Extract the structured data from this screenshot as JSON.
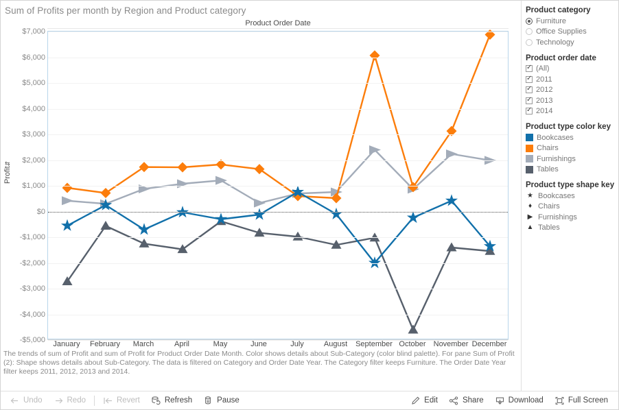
{
  "viz": {
    "title": "Sum of Profits per month by Region and Product category",
    "column_header": "Product Order Date",
    "yaxis_title": "Profit",
    "yaxis_sort_glyph": "⇵",
    "caption": "The trends of sum of Profit and sum of Profit for Product Order Date Month.  Color shows details about Sub-Category (color blind palette).  For pane Sum of Profit (2):  Shape shows details about Sub-Category. The data is filtered on Category and Order Date Year. The Category filter keeps Furniture. The Order Date Year filter keeps 2011, 2012, 2013 and 2014."
  },
  "chart_data": {
    "type": "line",
    "title": "Sum of Profits per month by Region and Product category",
    "xlabel": "Product Order Date",
    "ylabel": "Profit",
    "ylim": [
      -5000,
      7000
    ],
    "ytick_step": 1000,
    "grid": true,
    "legend_position": "right",
    "categories": [
      "January",
      "February",
      "March",
      "April",
      "May",
      "June",
      "July",
      "August",
      "September",
      "October",
      "November",
      "December"
    ],
    "ytick_labels": [
      "$7,000",
      "$6,000",
      "$5,000",
      "$4,000",
      "$3,000",
      "$2,000",
      "$1,000",
      "$0",
      "-$1,000",
      "-$2,000",
      "-$3,000",
      "-$4,000",
      "-$5,000"
    ],
    "series": [
      {
        "name": "Bookcases",
        "color": "#1170aa",
        "shape": "star",
        "values": [
          -550,
          250,
          -700,
          -30,
          -300,
          -120,
          760,
          -100,
          -2000,
          -240,
          420,
          -1350
        ]
      },
      {
        "name": "Chairs",
        "color": "#fc7d0b",
        "shape": "diamond",
        "values": [
          920,
          720,
          1730,
          1720,
          1830,
          1650,
          600,
          520,
          6070,
          950,
          3130,
          6880
        ]
      },
      {
        "name": "Furnishings",
        "color": "#a3acb9",
        "shape": "triangle-right",
        "values": [
          420,
          300,
          880,
          1080,
          1210,
          330,
          700,
          760,
          2400,
          870,
          2240,
          1990
        ]
      },
      {
        "name": "Tables",
        "color": "#57606c",
        "shape": "triangle-up",
        "values": [
          -2720,
          -560,
          -1250,
          -1470,
          -380,
          -830,
          -980,
          -1300,
          -1020,
          -4600,
          -1400,
          -1540
        ]
      }
    ]
  },
  "legend": {
    "category_filter": {
      "title": "Product category",
      "options": [
        {
          "label": "Furniture",
          "selected": true
        },
        {
          "label": "Office Supplies",
          "selected": false
        },
        {
          "label": "Technology",
          "selected": false
        }
      ]
    },
    "date_filter": {
      "title": "Product order date",
      "options": [
        {
          "label": "(All)",
          "checked": true
        },
        {
          "label": "2011",
          "checked": true
        },
        {
          "label": "2012",
          "checked": true
        },
        {
          "label": "2013",
          "checked": true
        },
        {
          "label": "2014",
          "checked": true
        }
      ]
    },
    "color_key": {
      "title": "Product type color key",
      "items": [
        {
          "label": "Bookcases",
          "color": "#1170aa"
        },
        {
          "label": "Chairs",
          "color": "#fc7d0b"
        },
        {
          "label": "Furnishings",
          "color": "#a3acb9"
        },
        {
          "label": "Tables",
          "color": "#57606c"
        }
      ]
    },
    "shape_key": {
      "title": "Product type shape key",
      "items": [
        {
          "label": "Bookcases",
          "glyph": "★"
        },
        {
          "label": "Chairs",
          "glyph": "♦"
        },
        {
          "label": "Furnishings",
          "glyph": "▶"
        },
        {
          "label": "Tables",
          "glyph": "▲"
        }
      ]
    }
  },
  "toolbar": {
    "undo": "Undo",
    "redo": "Redo",
    "revert": "Revert",
    "refresh": "Refresh",
    "pause": "Pause",
    "edit": "Edit",
    "share": "Share",
    "download": "Download",
    "fullscreen": "Full Screen"
  }
}
